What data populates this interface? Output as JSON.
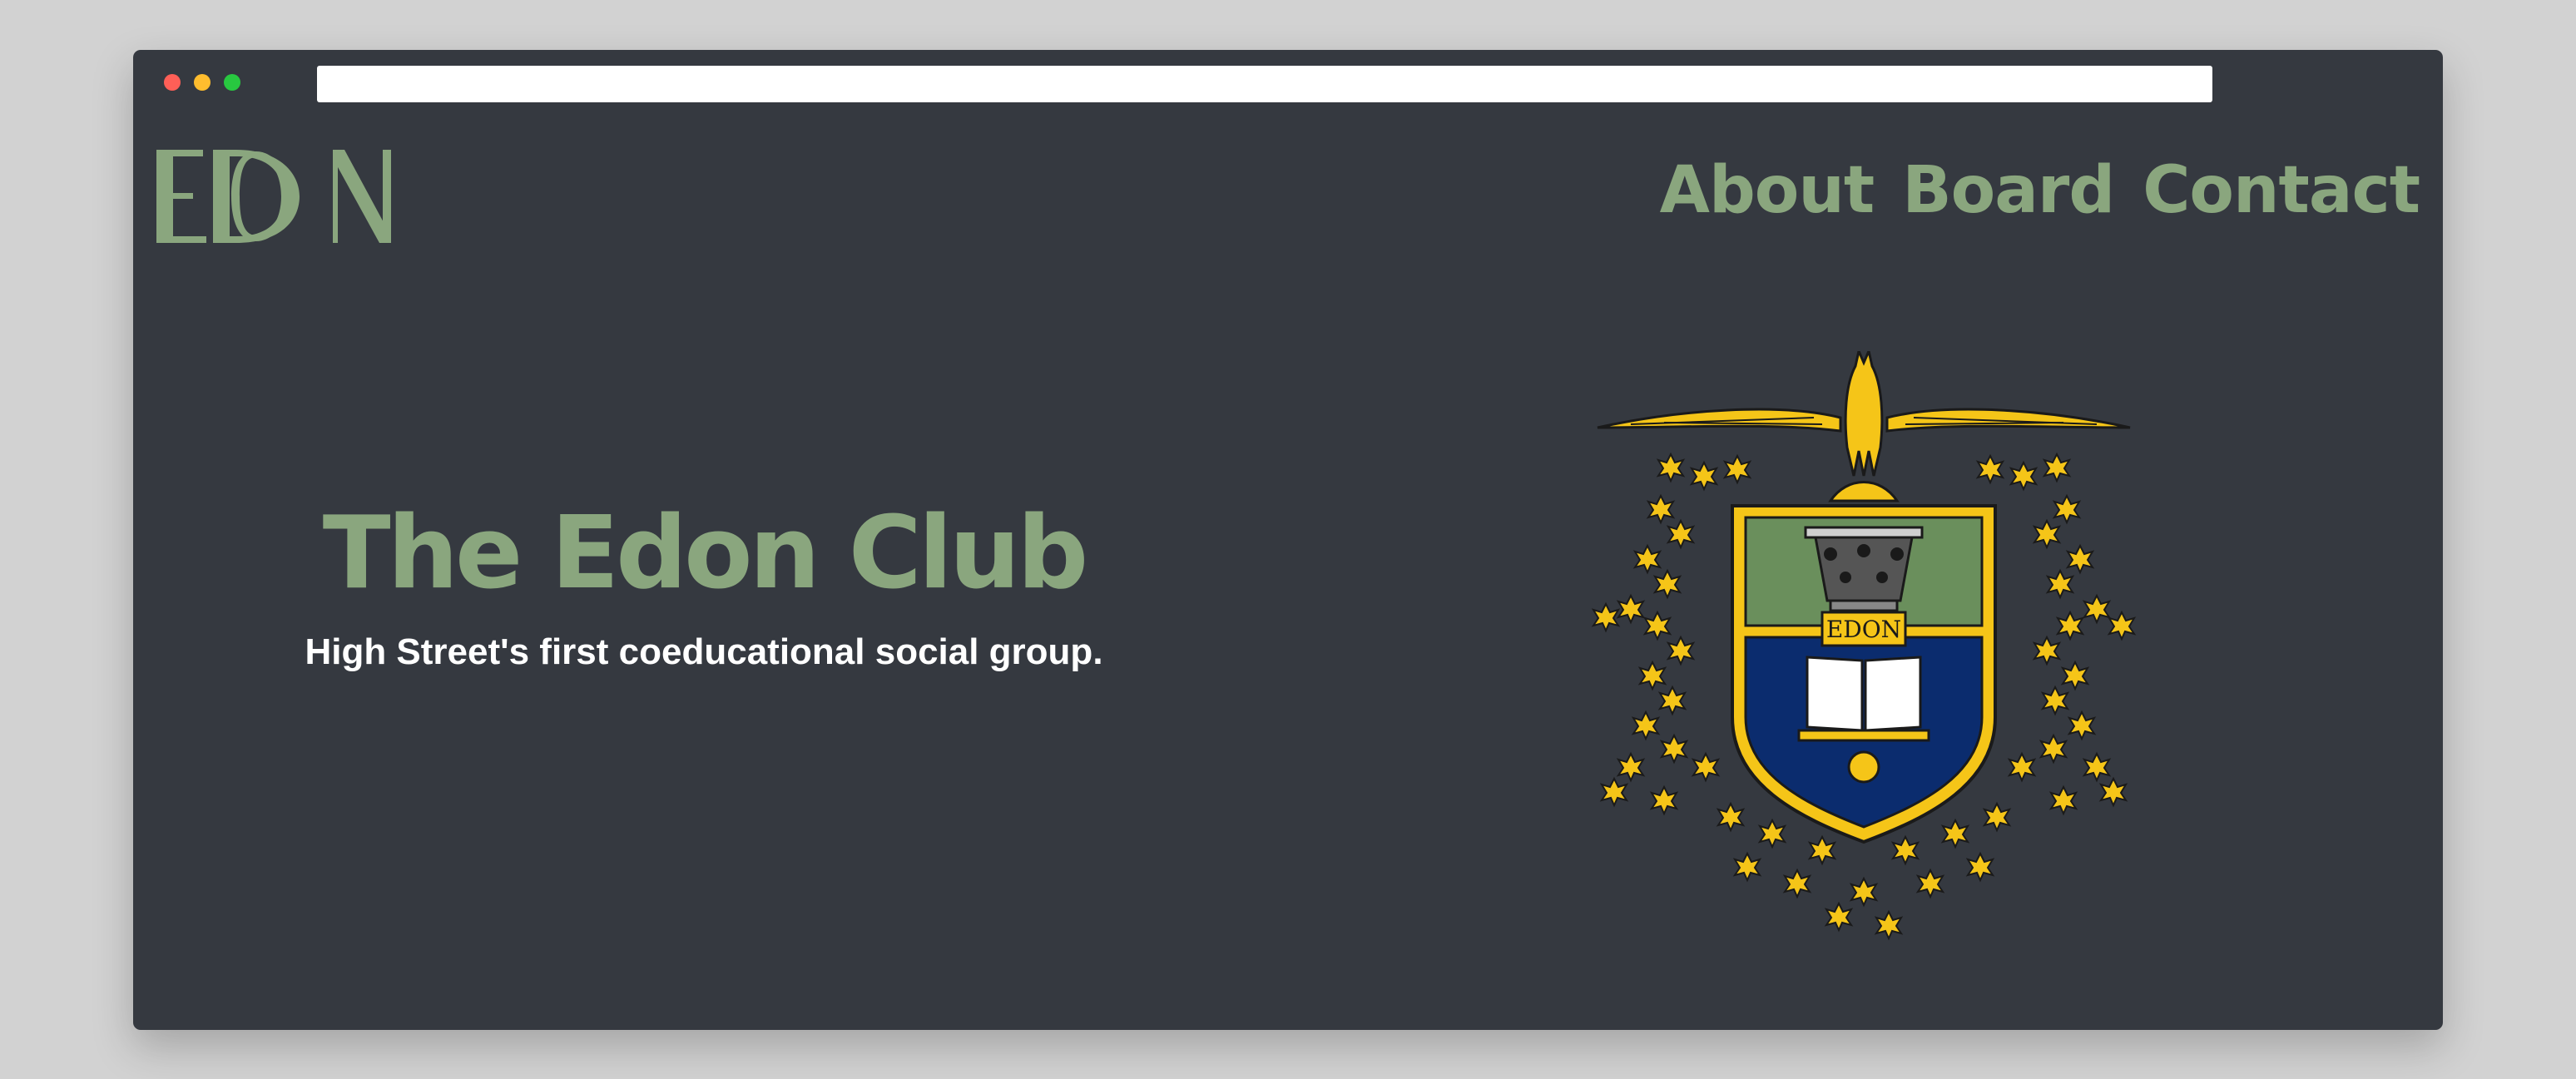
{
  "browser": {
    "window_controls": [
      "close",
      "minimize",
      "maximize"
    ],
    "url": ""
  },
  "header": {
    "logo_text": "EDON",
    "nav": [
      {
        "label": "About"
      },
      {
        "label": "Board"
      },
      {
        "label": "Contact"
      }
    ]
  },
  "hero": {
    "title": "The Edon Club",
    "subtitle": "High Street's first coeducational social group."
  },
  "crest": {
    "banner_text": "EDON",
    "colors": {
      "gold": "#f5c518",
      "green": "#6a8f5c",
      "navy": "#0b2c6e",
      "outline": "#1a1a1a"
    }
  },
  "colors": {
    "background": "#d2d2d2",
    "window": "#353940",
    "accent": "#8aa67e",
    "text_light": "#ffffff"
  }
}
